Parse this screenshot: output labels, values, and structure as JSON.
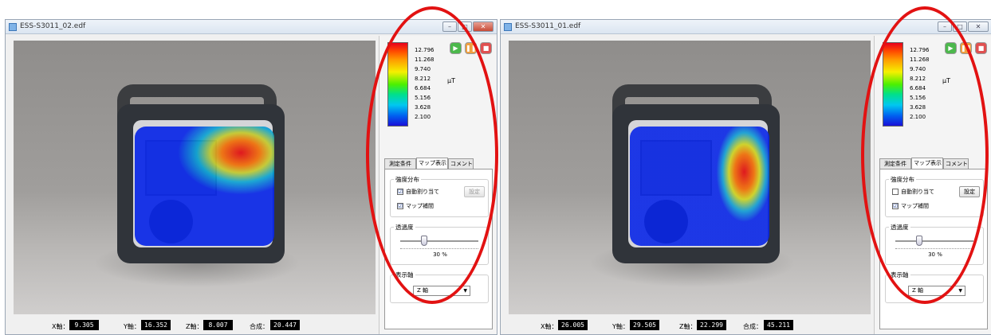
{
  "windows": [
    {
      "title": "ESS-S3011_02.edf",
      "colorbar": {
        "ticks": [
          "12.796",
          "11.268",
          "9.740",
          "8.212",
          "6.684",
          "5.156",
          "3.628",
          "2.100"
        ],
        "unit": "μT"
      },
      "tabs": [
        "測定条件",
        "マップ表示",
        "コメント"
      ],
      "intensity": {
        "label": "強度分布",
        "auto_assign": "自動割り当て",
        "auto_checked": "☑",
        "settings": "設定",
        "map_interp": "マップ補間",
        "interp_checked": "☑"
      },
      "transparency": {
        "label": "透過度",
        "value": "30 %",
        "level": 0.3
      },
      "axis": {
        "label": "表示軸",
        "selected": "Z 軸"
      },
      "readout": {
        "x_label": "X軸：",
        "x_value": "9.305",
        "y_label": "Y軸：",
        "y_value": "16.352",
        "z_label": "Z軸：",
        "z_value": "8.007",
        "sum_label": "合成：",
        "sum_value": "20.447"
      }
    },
    {
      "title": "ESS-S3011_01.edf",
      "colorbar": {
        "ticks": [
          "12.796",
          "11.268",
          "9.740",
          "8.212",
          "6.684",
          "5.156",
          "3.628",
          "2.100"
        ],
        "unit": "μT"
      },
      "tabs": [
        "測定条件",
        "マップ表示",
        "コメント"
      ],
      "intensity": {
        "label": "強度分布",
        "auto_assign": "自動割り当て",
        "auto_checked": "",
        "settings": "設定",
        "map_interp": "マップ補間",
        "interp_checked": "☑"
      },
      "transparency": {
        "label": "透過度",
        "value": "30 %",
        "level": 0.3
      },
      "axis": {
        "label": "表示軸",
        "selected": "Z 軸"
      },
      "readout": {
        "x_label": "X軸：",
        "x_value": "26.005",
        "y_label": "Y軸：",
        "y_value": "29.505",
        "z_label": "Z軸：",
        "z_value": "22.299",
        "sum_label": "合成：",
        "sum_value": "45.211"
      }
    }
  ],
  "colors": {
    "highlight": "#e21212"
  },
  "icons": {
    "play": "play-icon",
    "pause": "pause-icon",
    "stop": "stop-icon",
    "file": "document-icon"
  }
}
